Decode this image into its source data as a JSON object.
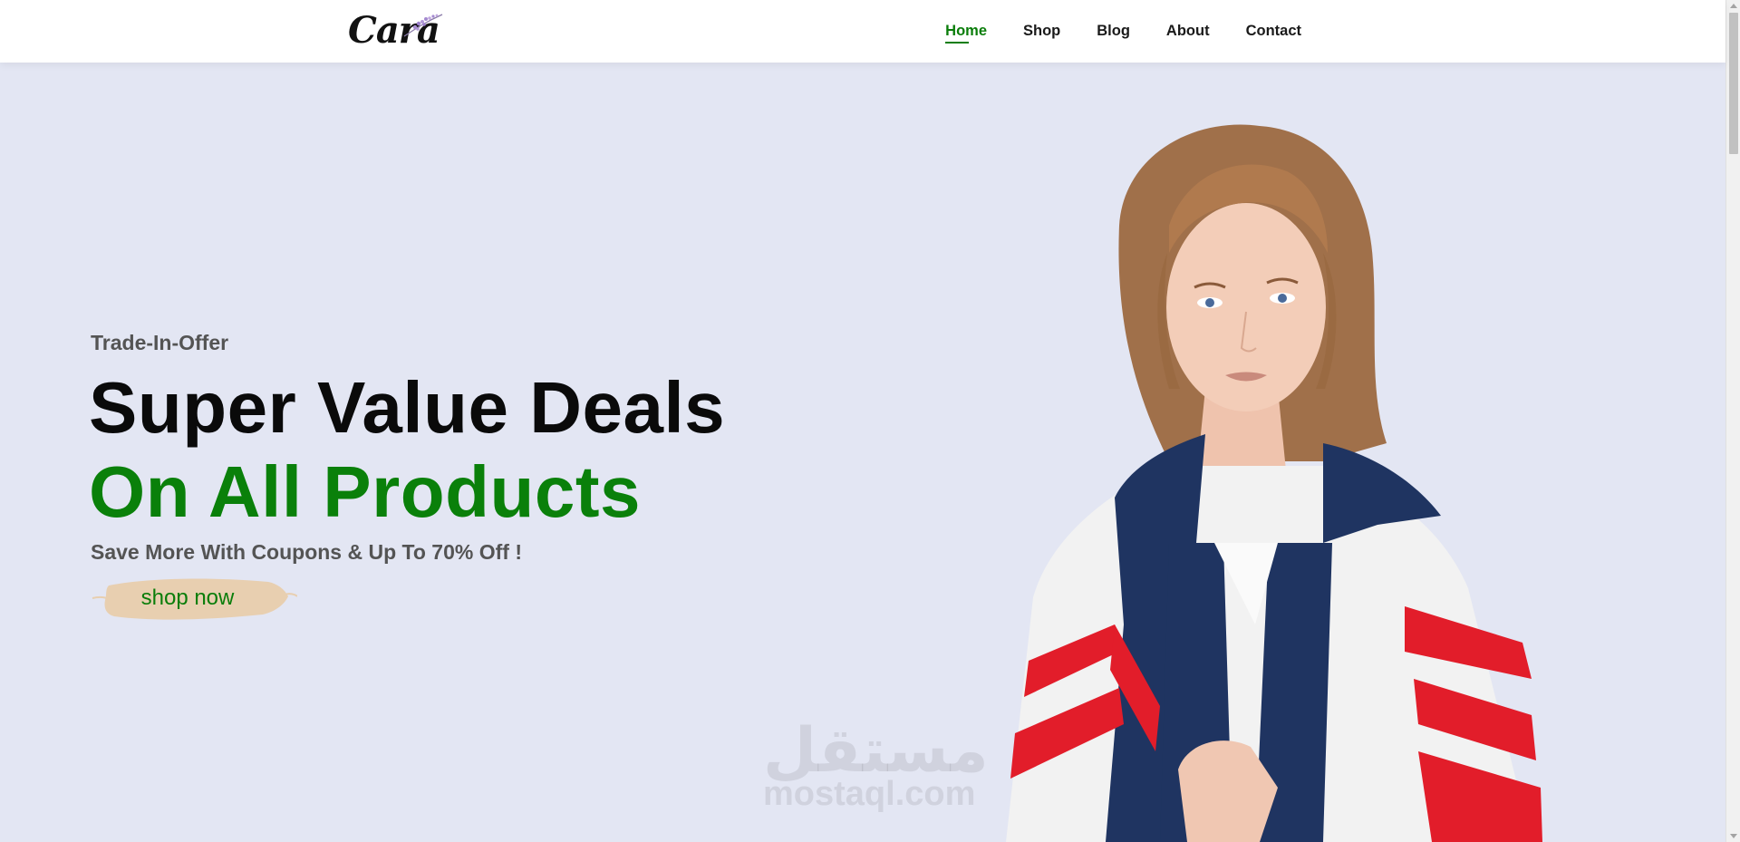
{
  "header": {
    "logo_text": "Cara",
    "nav": [
      {
        "label": "Home",
        "active": true
      },
      {
        "label": "Shop",
        "active": false
      },
      {
        "label": "Blog",
        "active": false
      },
      {
        "label": "About",
        "active": false
      },
      {
        "label": "Contact",
        "active": false
      }
    ],
    "cart_icon": "shopping-bag-icon"
  },
  "hero": {
    "subtitle": "Trade-In-Offer",
    "title_line1": "Super Value Deals",
    "title_line2": "On All Products",
    "description": "Save More With Coupons & Up To 70% Off !",
    "button_label": "shop now"
  },
  "watermark": {
    "arabic": "مستقل",
    "latin": "mostaql.com"
  },
  "colors": {
    "accent_green": "#0a800a",
    "hero_bg": "#e3e6f3",
    "button_brush": "#e8cfb0"
  }
}
